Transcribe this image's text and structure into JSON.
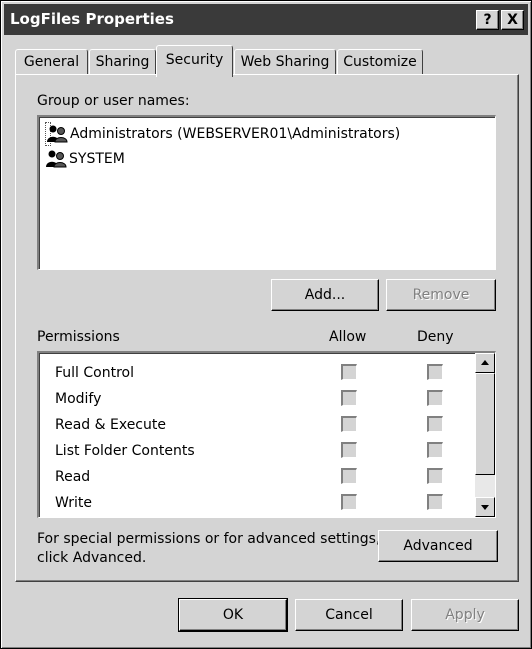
{
  "window": {
    "title": "LogFiles Properties",
    "help_label": "?",
    "close_label": "X"
  },
  "tabs": [
    {
      "label": "General"
    },
    {
      "label": "Sharing"
    },
    {
      "label": "Security"
    },
    {
      "label": "Web Sharing"
    },
    {
      "label": "Customize"
    }
  ],
  "active_tab": "Security",
  "users": {
    "header": "Group or user names:",
    "items": [
      {
        "name": "Administrators (WEBSERVER01\\Administrators)",
        "selected": true,
        "icon": "group-icon"
      },
      {
        "name": "SYSTEM",
        "selected": false,
        "icon": "group-icon"
      }
    ],
    "add_label": "Add...",
    "remove_label": "Remove"
  },
  "permissions": {
    "header": "Permissions",
    "allow_header": "Allow",
    "deny_header": "Deny",
    "rows": [
      {
        "name": "Full Control",
        "allow": false,
        "deny": false
      },
      {
        "name": "Modify",
        "allow": false,
        "deny": false
      },
      {
        "name": "Read & Execute",
        "allow": false,
        "deny": false
      },
      {
        "name": "List Folder Contents",
        "allow": false,
        "deny": false
      },
      {
        "name": "Read",
        "allow": false,
        "deny": false
      },
      {
        "name": "Write",
        "allow": false,
        "deny": false
      }
    ]
  },
  "advanced": {
    "text_line1": "For special permissions or for advanced settings,",
    "text_line2": "click Advanced.",
    "button_label": "Advanced"
  },
  "footer": {
    "ok_label": "OK",
    "cancel_label": "Cancel",
    "apply_label": "Apply"
  }
}
